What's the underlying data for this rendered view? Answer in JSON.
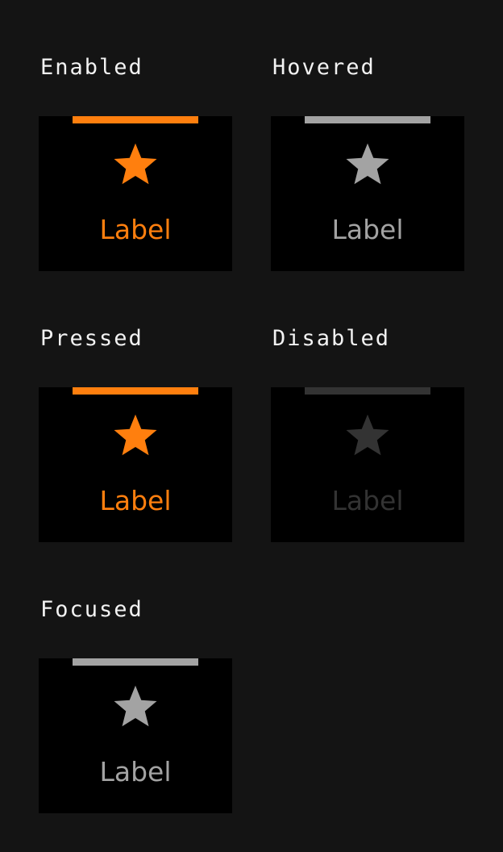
{
  "colors": {
    "background": "#141414",
    "tab_background": "#000000",
    "title_text": "#f2f2f2",
    "orange": "#ff7f0e",
    "gray": "#a3a3a3",
    "disabled": "#333333"
  },
  "states": [
    {
      "id": "enabled",
      "title": "Enabled",
      "label": "Label",
      "icon": "star-icon",
      "color": "#ff7f0e"
    },
    {
      "id": "hovered",
      "title": "Hovered",
      "label": "Label",
      "icon": "star-icon",
      "color": "#a3a3a3"
    },
    {
      "id": "pressed",
      "title": "Pressed",
      "label": "Label",
      "icon": "star-icon",
      "color": "#ff7f0e"
    },
    {
      "id": "disabled",
      "title": "Disabled",
      "label": "Label",
      "icon": "star-icon",
      "color": "#333333"
    },
    {
      "id": "focused",
      "title": "Focused",
      "label": "Label",
      "icon": "star-icon",
      "color": "#a3a3a3"
    }
  ]
}
